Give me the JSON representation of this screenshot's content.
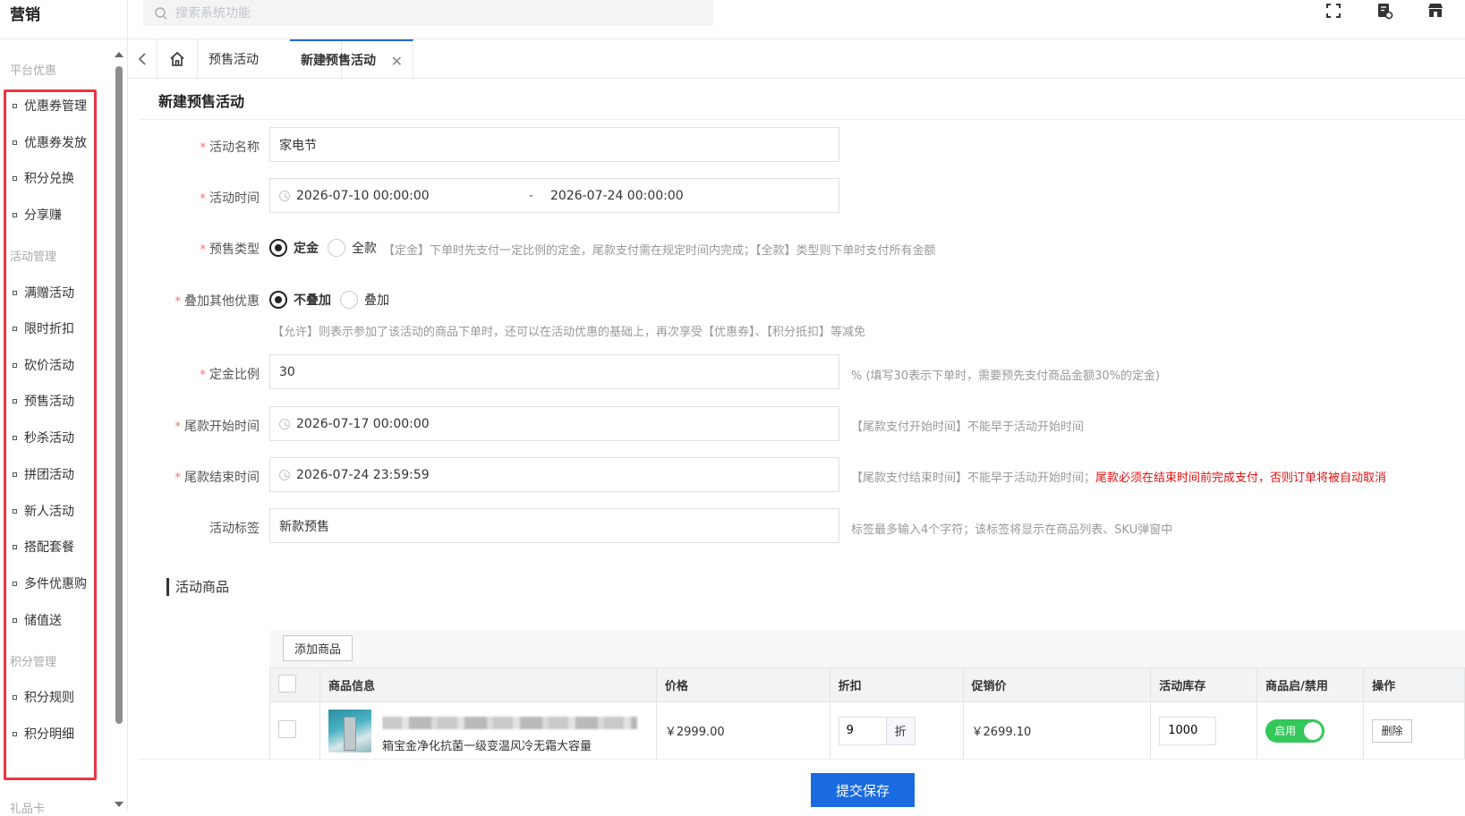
{
  "app": {
    "section_title": "营销"
  },
  "search": {
    "placeholder": "搜索系统功能"
  },
  "sidebar": {
    "groups": [
      {
        "label": "平台优惠",
        "items": [
          "优惠券管理",
          "优惠券发放",
          "积分兑换",
          "分享赚"
        ]
      },
      {
        "label": "活动管理",
        "items": [
          "满赠活动",
          "限时折扣",
          "砍价活动",
          "预售活动",
          "秒杀活动",
          "拼团活动",
          "新人活动",
          "搭配套餐",
          "多件优惠购",
          "储值送"
        ]
      },
      {
        "label": "积分管理",
        "items": [
          "积分规则",
          "积分明细"
        ]
      },
      {
        "label": "礼品卡",
        "items": []
      }
    ]
  },
  "tabs": [
    {
      "label": "预售活动",
      "active": false
    },
    {
      "label": "新建预售活动",
      "active": true
    }
  ],
  "page": {
    "title": "新建预售活动"
  },
  "form": {
    "name": {
      "label": "活动名称",
      "value": "家电节"
    },
    "time": {
      "label": "活动时间",
      "start": "2026-07-10 00:00:00",
      "sep": "-",
      "end": "2026-07-24 00:00:00"
    },
    "presale_type": {
      "label": "预售类型",
      "options": [
        "定金",
        "全款"
      ],
      "selected": "定金",
      "hint": "【定金】下单时先支付一定比例的定金，尾款支付需在规定时间内完成；【全款】类型则下单时支付所有金额"
    },
    "stack": {
      "label": "叠加其他优惠",
      "options": [
        "不叠加",
        "叠加"
      ],
      "selected": "不叠加",
      "hint": "【允许】则表示参加了该活动的商品下单时，还可以在活动优惠的基础上，再次享受【优惠券】、【积分抵扣】等减免"
    },
    "deposit": {
      "label": "定金比例",
      "value": "30",
      "hint": "% (填写30表示下单时，需要预先支付商品金额30%的定金)"
    },
    "balance_start": {
      "label": "尾款开始时间",
      "value": "2026-07-17 00:00:00",
      "hint": "【尾款支付开始时间】不能早于活动开始时间"
    },
    "balance_end": {
      "label": "尾款结束时间",
      "value": "2026-07-24 23:59:59",
      "hint": "【尾款支付结束时间】不能早于活动开始时间；",
      "hint_red": "尾款必须在结束时间前完成支付，否则订单将被自动取消"
    },
    "tag": {
      "label": "活动标签",
      "value": "新款预售",
      "hint": "标签最多输入4个字符；该标签将显示在商品列表、SKU弹窗中"
    }
  },
  "products": {
    "section_title": "活动商品",
    "add_button": "添加商品",
    "columns": [
      "商品信息",
      "价格",
      "折扣",
      "促销价",
      "活动库存",
      "商品启/禁用",
      "操作"
    ],
    "rows": [
      {
        "name": "箱宝金净化抗菌一级变温风冷无霜大容量",
        "price": "￥2999.00",
        "discount": "9",
        "discount_unit": "折",
        "promo_price": "￥2699.10",
        "stock": "1000",
        "switch_label": "启用",
        "delete": "删除"
      }
    ]
  },
  "footer": {
    "submit": "提交保存"
  },
  "colors": {
    "primary": "#1a6be0",
    "danger": "#e81010",
    "switch_on": "#34c759",
    "highlight": "#ee3344"
  }
}
